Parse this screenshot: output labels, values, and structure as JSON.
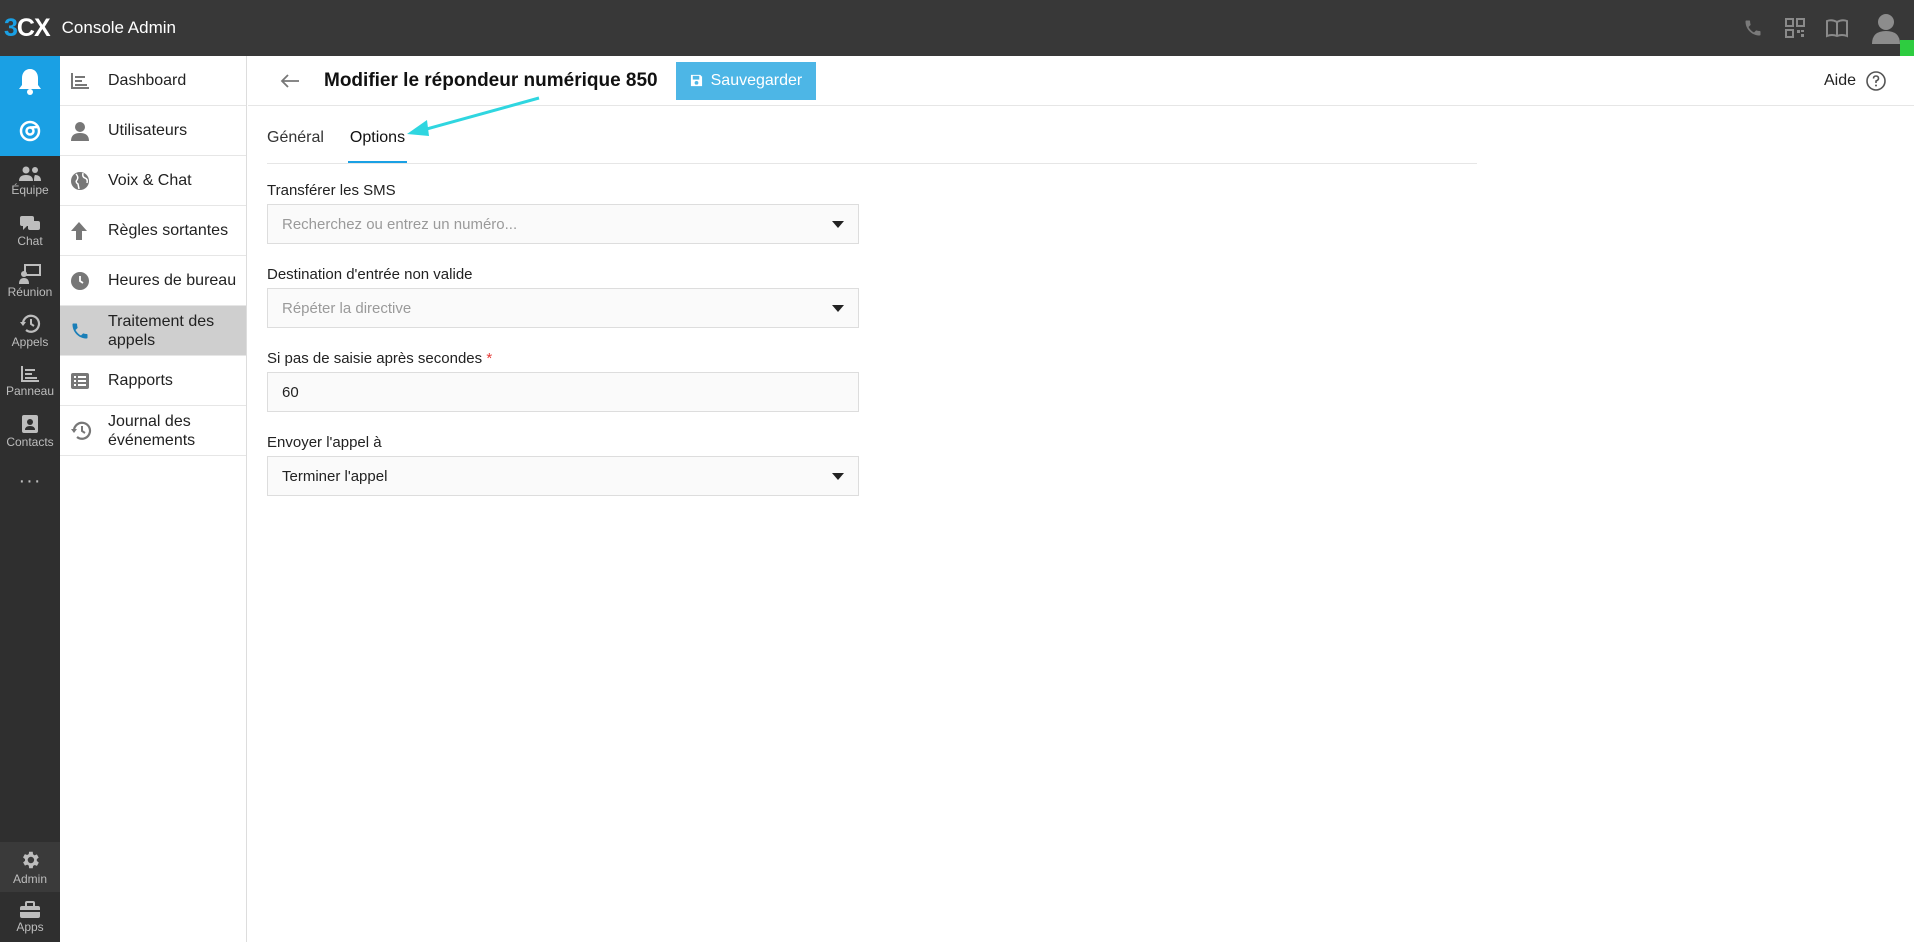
{
  "app": {
    "logo_text_3": "3",
    "logo_text_cx": "CX",
    "title": "Console Admin"
  },
  "topbar": {
    "icons": [
      "phone-icon",
      "qr-code-icon",
      "book-icon",
      "user-avatar-icon"
    ],
    "status_color": "#2ecc40"
  },
  "rail": {
    "items": [
      {
        "label": "Équipe",
        "icon": "team-icon"
      },
      {
        "label": "Chat",
        "icon": "chat-icon"
      },
      {
        "label": "Réunion",
        "icon": "meeting-icon"
      },
      {
        "label": "Appels",
        "icon": "history-icon"
      },
      {
        "label": "Panneau",
        "icon": "panel-icon"
      },
      {
        "label": "Contacts",
        "icon": "contacts-icon"
      }
    ],
    "more": "···",
    "admin": {
      "label": "Admin",
      "icon": "gear-icon"
    },
    "apps": {
      "label": "Apps",
      "icon": "apps-icon"
    }
  },
  "nav": {
    "items": [
      {
        "label": "Dashboard",
        "icon": "chart-icon"
      },
      {
        "label": "Utilisateurs",
        "icon": "user-icon"
      },
      {
        "label": "Voix & Chat",
        "icon": "globe-icon"
      },
      {
        "label": "Règles sortantes",
        "icon": "arrow-up-icon"
      },
      {
        "label": "Heures de bureau",
        "icon": "clock-icon"
      },
      {
        "label": "Traitement des appels",
        "icon": "phone-icon"
      },
      {
        "label": "Rapports",
        "icon": "list-icon"
      },
      {
        "label": "Journal des événements",
        "icon": "history-icon"
      }
    ]
  },
  "header": {
    "title": "Modifier le répondeur numérique 850",
    "save_label": "Sauvegarder",
    "help_label": "Aide"
  },
  "tabs": [
    {
      "label": "Général"
    },
    {
      "label": "Options"
    }
  ],
  "form": {
    "sms": {
      "label": "Transférer les SMS",
      "placeholder": "Recherchez ou entrez un numéro..."
    },
    "invalid_dest": {
      "label": "Destination d'entrée non valide",
      "placeholder": "Répéter la directive"
    },
    "timeout": {
      "label": "Si pas de saisie après secondes",
      "required": "*",
      "value": "60"
    },
    "send_call": {
      "label": "Envoyer l'appel à",
      "value": "Terminer l'appel"
    }
  },
  "colors": {
    "accent": "#1aa0e4",
    "save_button": "#4db6e6",
    "topbar": "#383838",
    "annotation_arrow": "#2fd6e0"
  }
}
